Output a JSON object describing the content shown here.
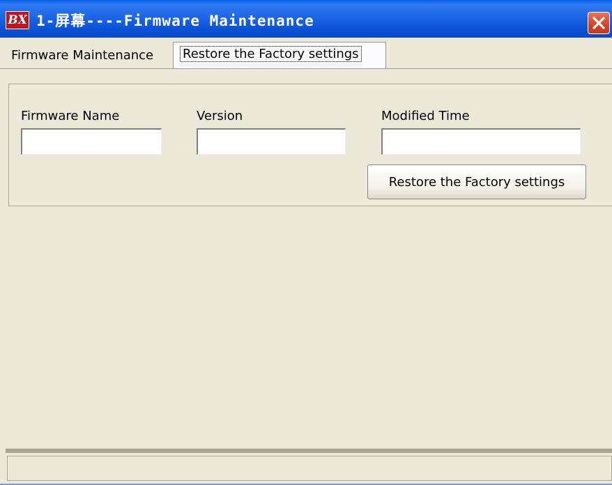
{
  "window": {
    "icon_text": "BX",
    "title": "1-屏幕----Firmware Maintenance"
  },
  "tabs": [
    {
      "label": "Firmware Maintenance",
      "selected": false
    },
    {
      "label": "Restore the Factory settings",
      "selected": true
    }
  ],
  "form": {
    "firmware_name_label": "Firmware Name",
    "firmware_name_value": "",
    "version_label": "Version",
    "version_value": "",
    "modified_time_label": "Modified Time",
    "modified_time_value": "",
    "restore_button_label": "Restore the Factory settings"
  },
  "status_bar": {
    "text": ""
  },
  "colors": {
    "titlebar": "#0a5fe8",
    "close_button": "#d5462c",
    "window_bg": "#ece9d8",
    "app_icon": "#c1121f"
  },
  "icons": {
    "app": "bx-logo-icon",
    "close": "close-icon"
  }
}
